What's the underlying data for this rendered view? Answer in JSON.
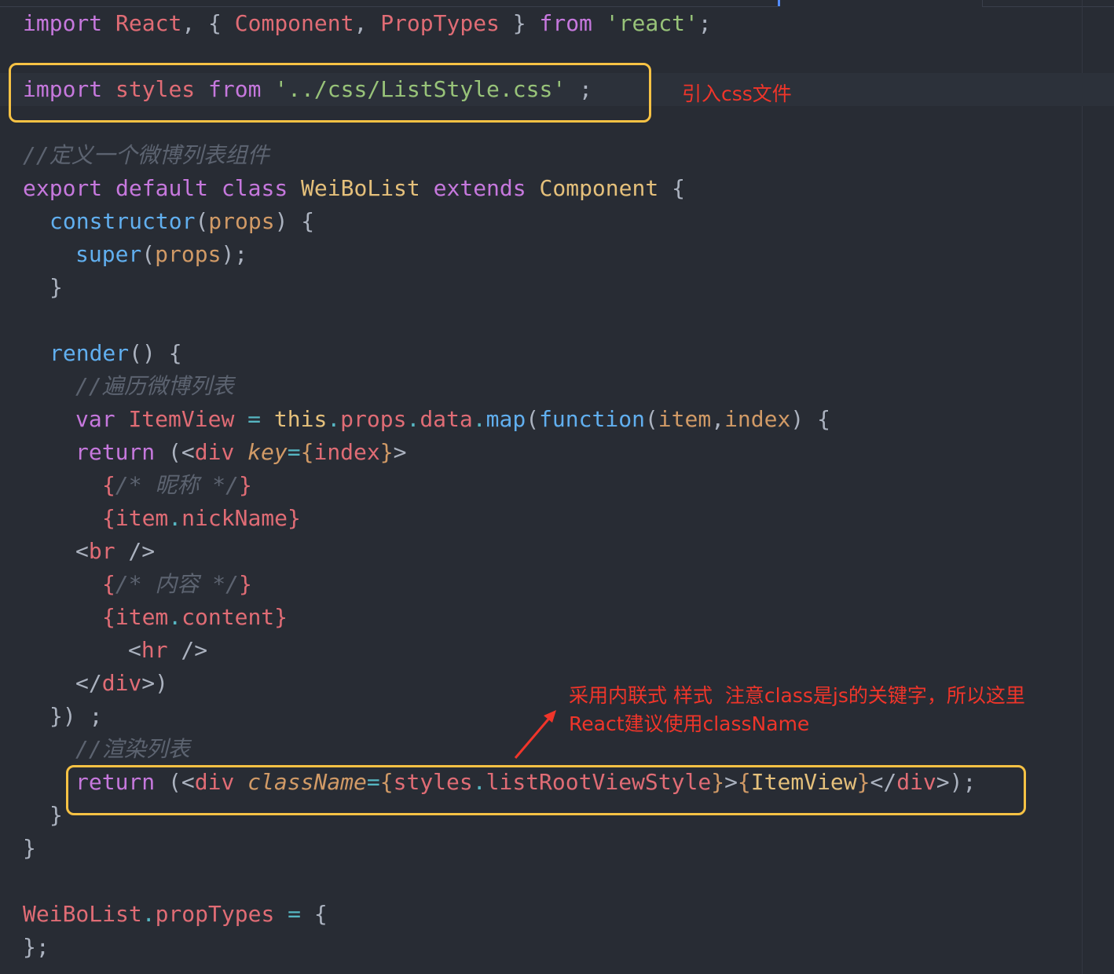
{
  "colors": {
    "background": "#282c34",
    "highlight_box": "#f7c244",
    "annotation": "#f0352a",
    "keyword": "#c678dd",
    "string": "#98c379",
    "function": "#61afef",
    "class": "#e5c07b",
    "variable": "#e06c75",
    "comment": "#5c6370"
  },
  "code": {
    "l1": {
      "t1": "import",
      "t2": "React",
      "t3": ", { ",
      "t4": "Component",
      "t5": ", ",
      "t6": "PropTypes",
      "t7": " } ",
      "t8": "from",
      "t9": " ",
      "t10": "'react'",
      "t11": ";"
    },
    "l2": {
      "t1": "import",
      "t2": " ",
      "t3": "styles",
      "t4": " ",
      "t5": "from",
      "t6": " ",
      "t7": "'../css/ListStyle.css'",
      "t8": " ;"
    },
    "l3": {
      "t1": "//定义一个微博列表组件"
    },
    "l4": {
      "t1": "export",
      "t2": " ",
      "t3": "default",
      "t4": " ",
      "t5": "class",
      "t6": " ",
      "t7": "WeiBoList",
      "t8": " ",
      "t9": "extends",
      "t10": " ",
      "t11": "Component",
      "t12": " {"
    },
    "l5": {
      "t1": "constructor",
      "t2": "(",
      "t3": "props",
      "t4": ") {"
    },
    "l6": {
      "t1": "super",
      "t2": "(",
      "t3": "props",
      "t4": ");"
    },
    "l7": {
      "t1": "}"
    },
    "l8": {
      "t1": "render",
      "t2": "() {"
    },
    "l9": {
      "t1": "//遍历微博列表"
    },
    "l10": {
      "t1": "var",
      "t2": " ",
      "t3": "ItemView",
      "t4": " = ",
      "t5": "this",
      "t6": ".",
      "t7": "props",
      "t8": ".",
      "t9": "data",
      "t10": ".",
      "t11": "map",
      "t12": "(",
      "t13": "function",
      "t14": "(",
      "t15": "item",
      "t16": ",",
      "t17": "index",
      "t18": ") {"
    },
    "l11": {
      "t1": "return",
      "t2": " (<",
      "t3": "div",
      "t4": " ",
      "t5": "key",
      "t6": "=",
      "t7": "{",
      "t8": "index",
      "t9": "}",
      "t10": ">"
    },
    "l12": {
      "t1": "{",
      "t2": "/* 昵称 */",
      "t3": "}"
    },
    "l13": {
      "t1": "{",
      "t2": "item",
      "t3": ".",
      "t4": "nickName",
      "t5": "}"
    },
    "l14": {
      "t1": "<",
      "t2": "br",
      "t3": " />"
    },
    "l15": {
      "t1": "{",
      "t2": "/* 内容 */",
      "t3": "}"
    },
    "l16": {
      "t1": "{",
      "t2": "item",
      "t3": ".",
      "t4": "content",
      "t5": "}"
    },
    "l17": {
      "t1": "<",
      "t2": "hr",
      "t3": " />"
    },
    "l18": {
      "t1": "</",
      "t2": "div",
      "t3": ">)"
    },
    "l19": {
      "t1": "}) ;"
    },
    "l20": {
      "t1": "//渲染列表"
    },
    "l21": {
      "t1": "return",
      "t2": " (<",
      "t3": "div",
      "t4": " ",
      "t5": "className",
      "t6": "=",
      "t7": "{",
      "t8": "styles",
      "t9": ".",
      "t10": "listRootViewStyle",
      "t11": "}",
      "t12": ">",
      "t13": "{",
      "t14": "ItemView",
      "t15": "}",
      "t16": "</",
      "t17": "div",
      "t18": ">);"
    },
    "l22": {
      "t1": "}"
    },
    "l23": {
      "t1": "}"
    },
    "l24": {
      "t1": "WeiBoList",
      "t2": ".",
      "t3": "propTypes",
      "t4": " = ",
      "t5": "{"
    },
    "l25": {
      "t1": "};"
    }
  },
  "annotations": {
    "import_css": "引入css文件",
    "inline_style_line1": "采用内联式 样式  注意class是js的关键字，所以这里",
    "inline_style_line2": "React建议使用className"
  }
}
